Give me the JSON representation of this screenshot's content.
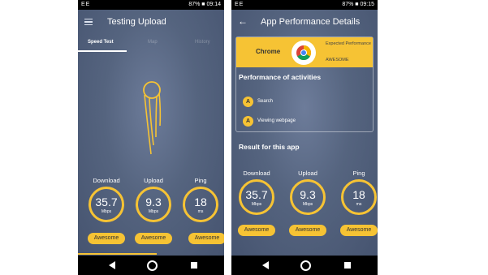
{
  "colors": {
    "accent": "#f6c334",
    "background": "#55647f",
    "statusbar": "#000000"
  },
  "screen1": {
    "status": {
      "left": "EE",
      "right": "87% ■ 09:14"
    },
    "title": "Testing Upload",
    "menu_icon": "hamburger-icon",
    "tabs": [
      {
        "label": "Speed Test",
        "active": true
      },
      {
        "label": "Map",
        "active": false
      },
      {
        "label": "History",
        "active": false
      }
    ],
    "progress": 0.54,
    "metrics": [
      {
        "label": "Download",
        "value": "35.7",
        "unit": "Mbps",
        "rating": "Awesome"
      },
      {
        "label": "Upload",
        "value": "9.3",
        "unit": "Mbps",
        "rating": "Awesome"
      },
      {
        "label": "Ping",
        "value": "18",
        "unit": "ms",
        "rating": "Awesome"
      }
    ]
  },
  "screen2": {
    "status": {
      "left": "EE",
      "right": "87% ■ 09:15"
    },
    "title": "App Performance Details",
    "back_icon": "arrow-left-icon",
    "app_name": "Chrome",
    "app_icon": "chrome-icon",
    "expected_label": "Expected Performance",
    "expected_value": "AWESOME",
    "activities_title": "Performance of activities",
    "activities": [
      {
        "grade": "A",
        "label": "Search"
      },
      {
        "grade": "A",
        "label": "Viewing webpage"
      }
    ],
    "result_title": "Result for this app",
    "metrics": [
      {
        "label": "Download",
        "value": "35.7",
        "unit": "Mbps",
        "rating": "Awesome"
      },
      {
        "label": "Upload",
        "value": "9.3",
        "unit": "Mbps",
        "rating": "Awesome"
      },
      {
        "label": "Ping",
        "value": "18",
        "unit": "ms",
        "rating": "Awesome"
      }
    ]
  },
  "nav": {
    "back_icon": "triangle-back-icon",
    "home_icon": "circle-home-icon",
    "recents_icon": "square-recents-icon"
  }
}
